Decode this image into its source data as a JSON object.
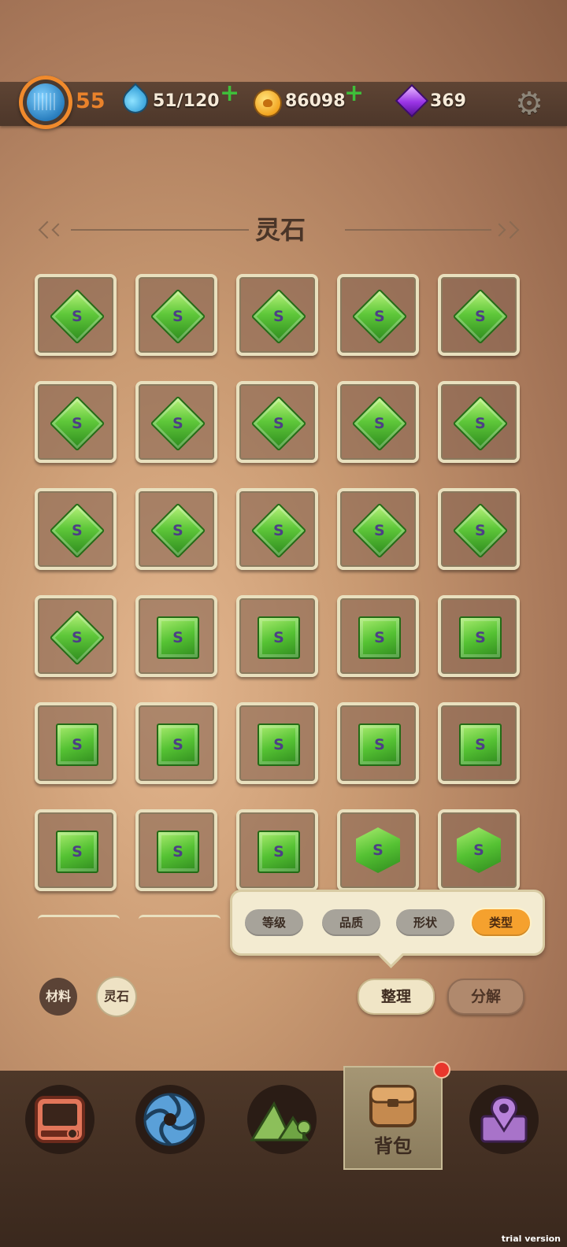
{
  "header": {
    "level": "55",
    "stamina": "51/120",
    "coins": "86098",
    "gems": "369",
    "plus_symbol": "+"
  },
  "title": "灵石",
  "grid_items": [
    "S",
    "S",
    "S",
    "S",
    "S",
    "S",
    "S",
    "S",
    "S",
    "S",
    "S",
    "S",
    "S",
    "S",
    "S",
    "S",
    "S",
    "S",
    "S",
    "S",
    "S",
    "S",
    "S",
    "S",
    "S",
    "S",
    "S",
    "S",
    "S",
    "S"
  ],
  "sort_options": [
    "等级",
    "品质",
    "形状",
    "类型"
  ],
  "active_sort": "类型",
  "categories": {
    "material": "材料",
    "spirit_stone": "灵石"
  },
  "actions": {
    "arrange": "整理",
    "decompose": "分解"
  },
  "nav": {
    "active_label": "背包",
    "items": [
      "shop-icon",
      "portal-icon",
      "mountain-icon",
      "backpack-icon",
      "map-pin-icon"
    ]
  },
  "watermark": "trial version",
  "colors": {
    "accent_orange": "#f5a12e",
    "stone_green": "#55c233",
    "stone_letter": "#4d3f86",
    "badge_red": "#e8362c"
  }
}
